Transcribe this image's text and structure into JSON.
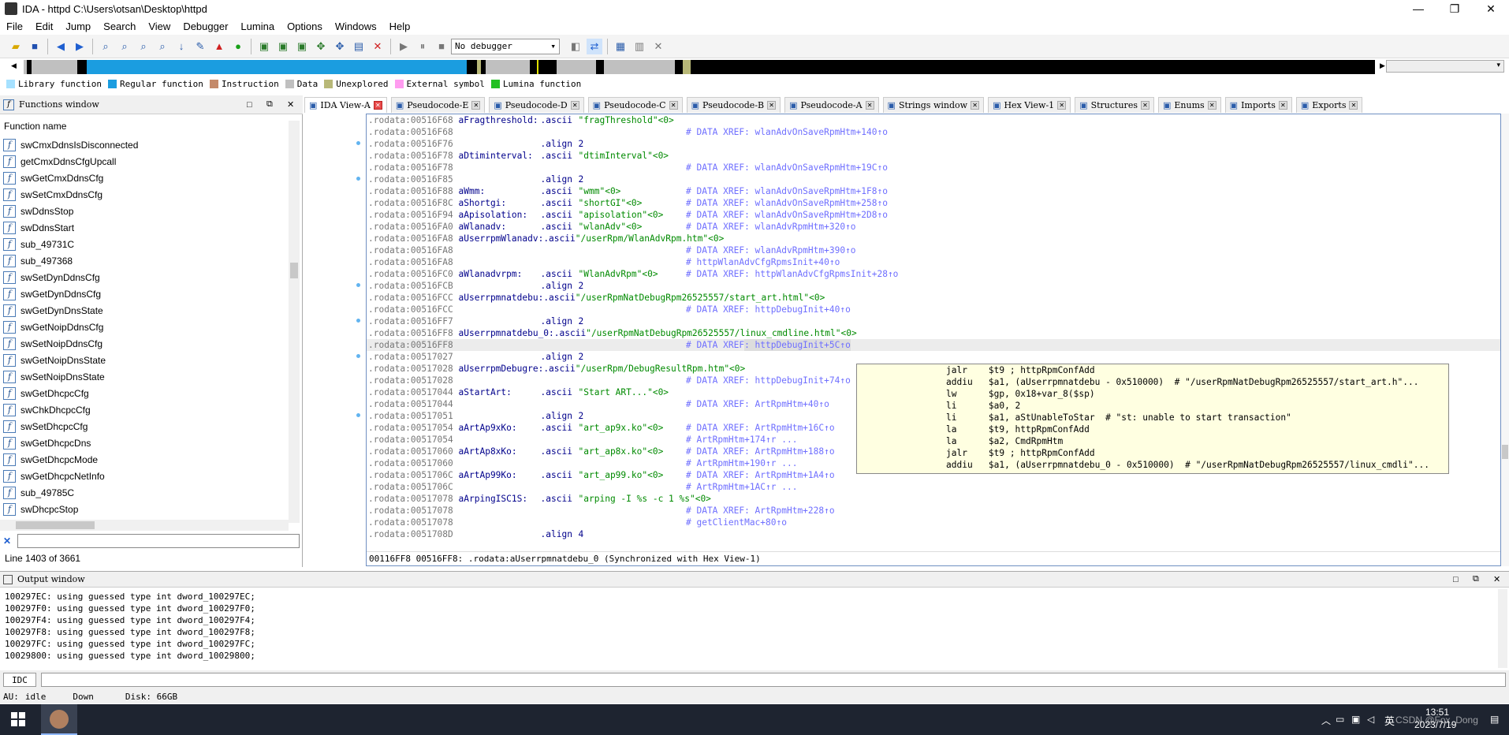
{
  "window": {
    "title": "IDA - httpd C:\\Users\\otsan\\Desktop\\httpd"
  },
  "menu": [
    "File",
    "Edit",
    "Jump",
    "Search",
    "View",
    "Debugger",
    "Lumina",
    "Options",
    "Windows",
    "Help"
  ],
  "toolbar": {
    "debugger_select": "No debugger"
  },
  "legend": [
    {
      "label": "Library function",
      "color": "#a6e1ff"
    },
    {
      "label": "Regular function",
      "color": "#1b9de0"
    },
    {
      "label": "Instruction",
      "color": "#c48a6a"
    },
    {
      "label": "Data",
      "color": "#c0c0c0"
    },
    {
      "label": "Unexplored",
      "color": "#b8b878"
    },
    {
      "label": "External symbol",
      "color": "#ff9cf0"
    },
    {
      "label": "Lumina function",
      "color": "#23c023"
    }
  ],
  "functions_window": {
    "title": "Functions window",
    "column": "Function name",
    "items": [
      "swCmxDdnsIsDisconnected",
      "getCmxDdnsCfgUpcall",
      "swGetCmxDdnsCfg",
      "swSetCmxDdnsCfg",
      "swDdnsStop",
      "swDdnsStart",
      "sub_49731C",
      "sub_497368",
      "swSetDynDdnsCfg",
      "swGetDynDdnsCfg",
      "swGetDynDnsState",
      "swGetNoipDdnsCfg",
      "swSetNoipDdnsCfg",
      "swGetNoipDnsState",
      "swSetNoipDnsState",
      "swGetDhcpcCfg",
      "swChkDhcpcCfg",
      "swSetDhcpcCfg",
      "swGetDhcpcDns",
      "swGetDhcpcMode",
      "swGetDhcpcNetInfo",
      "sub_49785C",
      "swDhcpcStop"
    ],
    "line_status": "Line 1403 of 3661"
  },
  "tabs": [
    "IDA View-A",
    "Pseudocode-E",
    "Pseudocode-D",
    "Pseudocode-C",
    "Pseudocode-B",
    "Pseudocode-A",
    "Strings window",
    "Hex View-1",
    "Structures",
    "Enums",
    "Imports",
    "Exports"
  ],
  "code_lines": [
    {
      "addr": ".rodata:00516F68",
      "name": "aFragthreshold:",
      "op": ".ascii",
      "val": "\"fragThreshold\"<0>",
      "cmt": ""
    },
    {
      "addr": ".rodata:00516F68",
      "name": "",
      "op": "",
      "val": "",
      "cmt": "# DATA XREF: wlanAdvOnSaveRpmHtm+140↑o"
    },
    {
      "addr": ".rodata:00516F76",
      "name": "",
      "op": ".align",
      "val": "2",
      "cmt": ""
    },
    {
      "addr": ".rodata:00516F78",
      "name": "aDtiminterval:",
      "op": ".ascii",
      "val": "\"dtimInterval\"<0>",
      "cmt": ""
    },
    {
      "addr": ".rodata:00516F78",
      "name": "",
      "op": "",
      "val": "",
      "cmt": "# DATA XREF: wlanAdvOnSaveRpmHtm+19C↑o"
    },
    {
      "addr": ".rodata:00516F85",
      "name": "",
      "op": ".align",
      "val": "2",
      "cmt": ""
    },
    {
      "addr": ".rodata:00516F88",
      "name": "aWmm:",
      "op": ".ascii",
      "val": "\"wmm\"<0>",
      "cmt": "# DATA XREF: wlanAdvOnSaveRpmHtm+1F8↑o"
    },
    {
      "addr": ".rodata:00516F8C",
      "name": "aShortgi:",
      "op": ".ascii",
      "val": "\"shortGI\"<0>",
      "cmt": "# DATA XREF: wlanAdvOnSaveRpmHtm+258↑o"
    },
    {
      "addr": ".rodata:00516F94",
      "name": "aApisolation:",
      "op": ".ascii",
      "val": "\"apisolation\"<0>",
      "cmt": "# DATA XREF: wlanAdvOnSaveRpmHtm+2D8↑o"
    },
    {
      "addr": ".rodata:00516FA0",
      "name": "aWlanadv:",
      "op": ".ascii",
      "val": "\"wlanAdv\"<0>",
      "cmt": "# DATA XREF: wlanAdvRpmHtm+320↑o"
    },
    {
      "addr": ".rodata:00516FA8",
      "name": "aUserrpmWlanadv:",
      "op": ".ascii",
      "val": "\"/userRpm/WlanAdvRpm.htm\"<0>",
      "cmt": ""
    },
    {
      "addr": ".rodata:00516FA8",
      "name": "",
      "op": "",
      "val": "",
      "cmt": "# DATA XREF: wlanAdvRpmHtm+390↑o"
    },
    {
      "addr": ".rodata:00516FA8",
      "name": "",
      "op": "",
      "val": "",
      "cmt": "# httpWlanAdvCfgRpmsInit+40↑o"
    },
    {
      "addr": ".rodata:00516FC0",
      "name": "aWlanadvrpm:",
      "op": ".ascii",
      "val": "\"WlanAdvRpm\"<0>",
      "cmt": "# DATA XREF: httpWlanAdvCfgRpmsInit+28↑o"
    },
    {
      "addr": ".rodata:00516FCB",
      "name": "",
      "op": ".align",
      "val": "2",
      "cmt": ""
    },
    {
      "addr": ".rodata:00516FCC",
      "name": "aUserrpmnatdebu:",
      "op": ".ascii",
      "val": "\"/userRpmNatDebugRpm26525557/start_art.html\"<0>",
      "cmt": ""
    },
    {
      "addr": ".rodata:00516FCC",
      "name": "",
      "op": "",
      "val": "",
      "cmt": "# DATA XREF: httpDebugInit+40↑o"
    },
    {
      "addr": ".rodata:00516FF7",
      "name": "",
      "op": ".align",
      "val": "2",
      "cmt": ""
    },
    {
      "addr": ".rodata:00516FF8",
      "name": "aUserrpmnatdebu_0:",
      "op": ".ascii",
      "val": "\"/userRpmNatDebugRpm26525557/linux_cmdline.html\"<0>",
      "cmt": ""
    },
    {
      "addr": ".rodata:00516FF8",
      "name": "",
      "op": "",
      "val": "",
      "cmt": "# DATA XREF: httpDebugInit+5C↑o"
    },
    {
      "addr": ".rodata:00517027",
      "name": "",
      "op": ".align",
      "val": "2",
      "cmt": ""
    },
    {
      "addr": ".rodata:00517028",
      "name": "aUserrpmDebugre:",
      "op": ".ascii",
      "val": "\"/userRpm/DebugResultRpm.htm\"<0>",
      "cmt": ""
    },
    {
      "addr": ".rodata:00517028",
      "name": "",
      "op": "",
      "val": "",
      "cmt": "# DATA XREF: httpDebugInit+74↑o"
    },
    {
      "addr": ".rodata:00517044",
      "name": "aStartArt:",
      "op": ".ascii",
      "val": "\"Start ART...\"<0>",
      "cmt": ""
    },
    {
      "addr": ".rodata:00517044",
      "name": "",
      "op": "",
      "val": "",
      "cmt": "# DATA XREF: ArtRpmHtm+40↑o"
    },
    {
      "addr": ".rodata:00517051",
      "name": "",
      "op": ".align",
      "val": "2",
      "cmt": ""
    },
    {
      "addr": ".rodata:00517054",
      "name": "aArtAp9xKo:",
      "op": ".ascii",
      "val": "\"art_ap9x.ko\"<0>",
      "cmt": "# DATA XREF: ArtRpmHtm+16C↑o"
    },
    {
      "addr": ".rodata:00517054",
      "name": "",
      "op": "",
      "val": "",
      "cmt": "# ArtRpmHtm+174↑r ..."
    },
    {
      "addr": ".rodata:00517060",
      "name": "aArtAp8xKo:",
      "op": ".ascii",
      "val": "\"art_ap8x.ko\"<0>",
      "cmt": "# DATA XREF: ArtRpmHtm+188↑o"
    },
    {
      "addr": ".rodata:00517060",
      "name": "",
      "op": "",
      "val": "",
      "cmt": "# ArtRpmHtm+190↑r ..."
    },
    {
      "addr": ".rodata:0051706C",
      "name": "aArtAp99Ko:",
      "op": ".ascii",
      "val": "\"art_ap99.ko\"<0>",
      "cmt": "# DATA XREF: ArtRpmHtm+1A4↑o"
    },
    {
      "addr": ".rodata:0051706C",
      "name": "",
      "op": "",
      "val": "",
      "cmt": "# ArtRpmHtm+1AC↑r ..."
    },
    {
      "addr": ".rodata:00517078",
      "name": "aArpingISC1S:",
      "op": ".ascii",
      "val": "\"arping -I %s -c 1 %s\"<0>",
      "cmt": ""
    },
    {
      "addr": ".rodata:00517078",
      "name": "",
      "op": "",
      "val": "",
      "cmt": "# DATA XREF: ArtRpmHtm+228↑o"
    },
    {
      "addr": ".rodata:00517078",
      "name": "",
      "op": "",
      "val": "",
      "cmt": "# getClientMac+80↑o"
    },
    {
      "addr": ".rodata:0051708D",
      "name": "",
      "op": ".align",
      "val": "4",
      "cmt": ""
    }
  ],
  "code_status": "00116FF8 00516FF8: .rodata:aUserrpmnatdebu_0 (Synchronized with Hex View-1)",
  "popup_lines": [
    "jalr    $t9 ; httpRpmConfAdd",
    "addiu   $a1, (aUserrpmnatdebu - 0x510000)  # \"/userRpmNatDebugRpm26525557/start_art.h\"...",
    "lw      $gp, 0x18+var_8($sp)",
    "li      $a0, 2",
    "li      $a1, aStUnableToStar  # \"st: unable to start transaction\"",
    "la      $t9, httpRpmConfAdd",
    "la      $a2, CmdRpmHtm",
    "jalr    $t9 ; httpRpmConfAdd",
    "addiu   $a1, (aUserrpmnatdebu_0 - 0x510000)  # \"/userRpmNatDebugRpm26525557/linux_cmdli\"..."
  ],
  "output_window": {
    "title": "Output window",
    "lines": [
      "100297EC: using guessed type int dword_100297EC;",
      "100297F0: using guessed type int dword_100297F0;",
      "100297F4: using guessed type int dword_100297F4;",
      "100297F8: using guessed type int dword_100297F8;",
      "100297FC: using guessed type int dword_100297FC;",
      "10029800: using guessed type int dword_10029800;"
    ]
  },
  "idc": {
    "label": "IDC"
  },
  "status": {
    "au": "AU:",
    "state": "idle",
    "direction": "Down",
    "disk": "Disk: 66GB"
  },
  "taskbar": {
    "time": "13:51",
    "date": "2023/7/19",
    "ime": "英",
    "watermark": "CSDN @Fox_Dong"
  }
}
